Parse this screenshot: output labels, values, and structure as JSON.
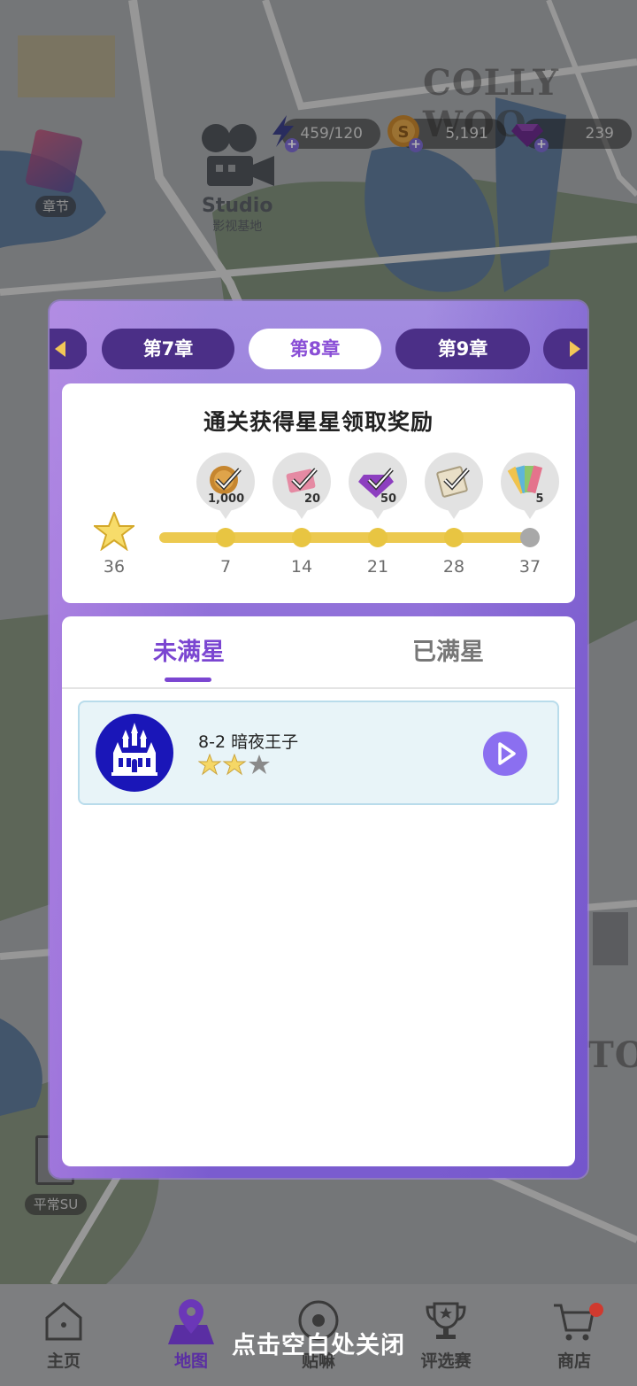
{
  "map": {
    "label_colly": "COLLY WOO",
    "label_to": "TO",
    "studio_en": "Studio",
    "studio_cn": "影视基地",
    "chapter_side_label": "章节",
    "normal_su_label": "平常SU"
  },
  "resources": {
    "energy": "459/120",
    "coins": "5,191",
    "gems": "239"
  },
  "modal": {
    "chapter_tabs": [
      "第7章",
      "第8章",
      "第9章"
    ],
    "active_chapter": "第8章",
    "reward_title": "通关获得星星领取奖励",
    "current_stars": "36",
    "milestones": [
      {
        "stars": "7",
        "reward_icon": "coin-reward-icon",
        "amount": "1,000",
        "claimed": true
      },
      {
        "stars": "14",
        "reward_icon": "ticket-reward-icon",
        "amount": "20",
        "claimed": true
      },
      {
        "stars": "21",
        "reward_icon": "gem-reward-icon",
        "amount": "50",
        "claimed": true
      },
      {
        "stars": "28",
        "reward_icon": "paper-reward-icon",
        "amount": "",
        "claimed": true
      },
      {
        "stars": "37",
        "reward_icon": "palette-reward-icon",
        "amount": "5",
        "claimed": false
      }
    ],
    "list_tabs": {
      "unfull": "未满星",
      "full": "已满星"
    },
    "stages": [
      {
        "name": "8-2 暗夜王子",
        "stars_earned": 2,
        "stars_total": 3
      }
    ]
  },
  "nav": {
    "items": [
      "主页",
      "地图",
      "贴嘛",
      "评选赛",
      "商店"
    ],
    "active": "地图",
    "close_hint": "点击空白处关闭"
  },
  "colors": {
    "accent_purple": "#7b46d1",
    "tab_dark": "#4b2f87",
    "progress_yellow": "#ecc94f",
    "stage_icon_blue": "#1a16b8"
  }
}
